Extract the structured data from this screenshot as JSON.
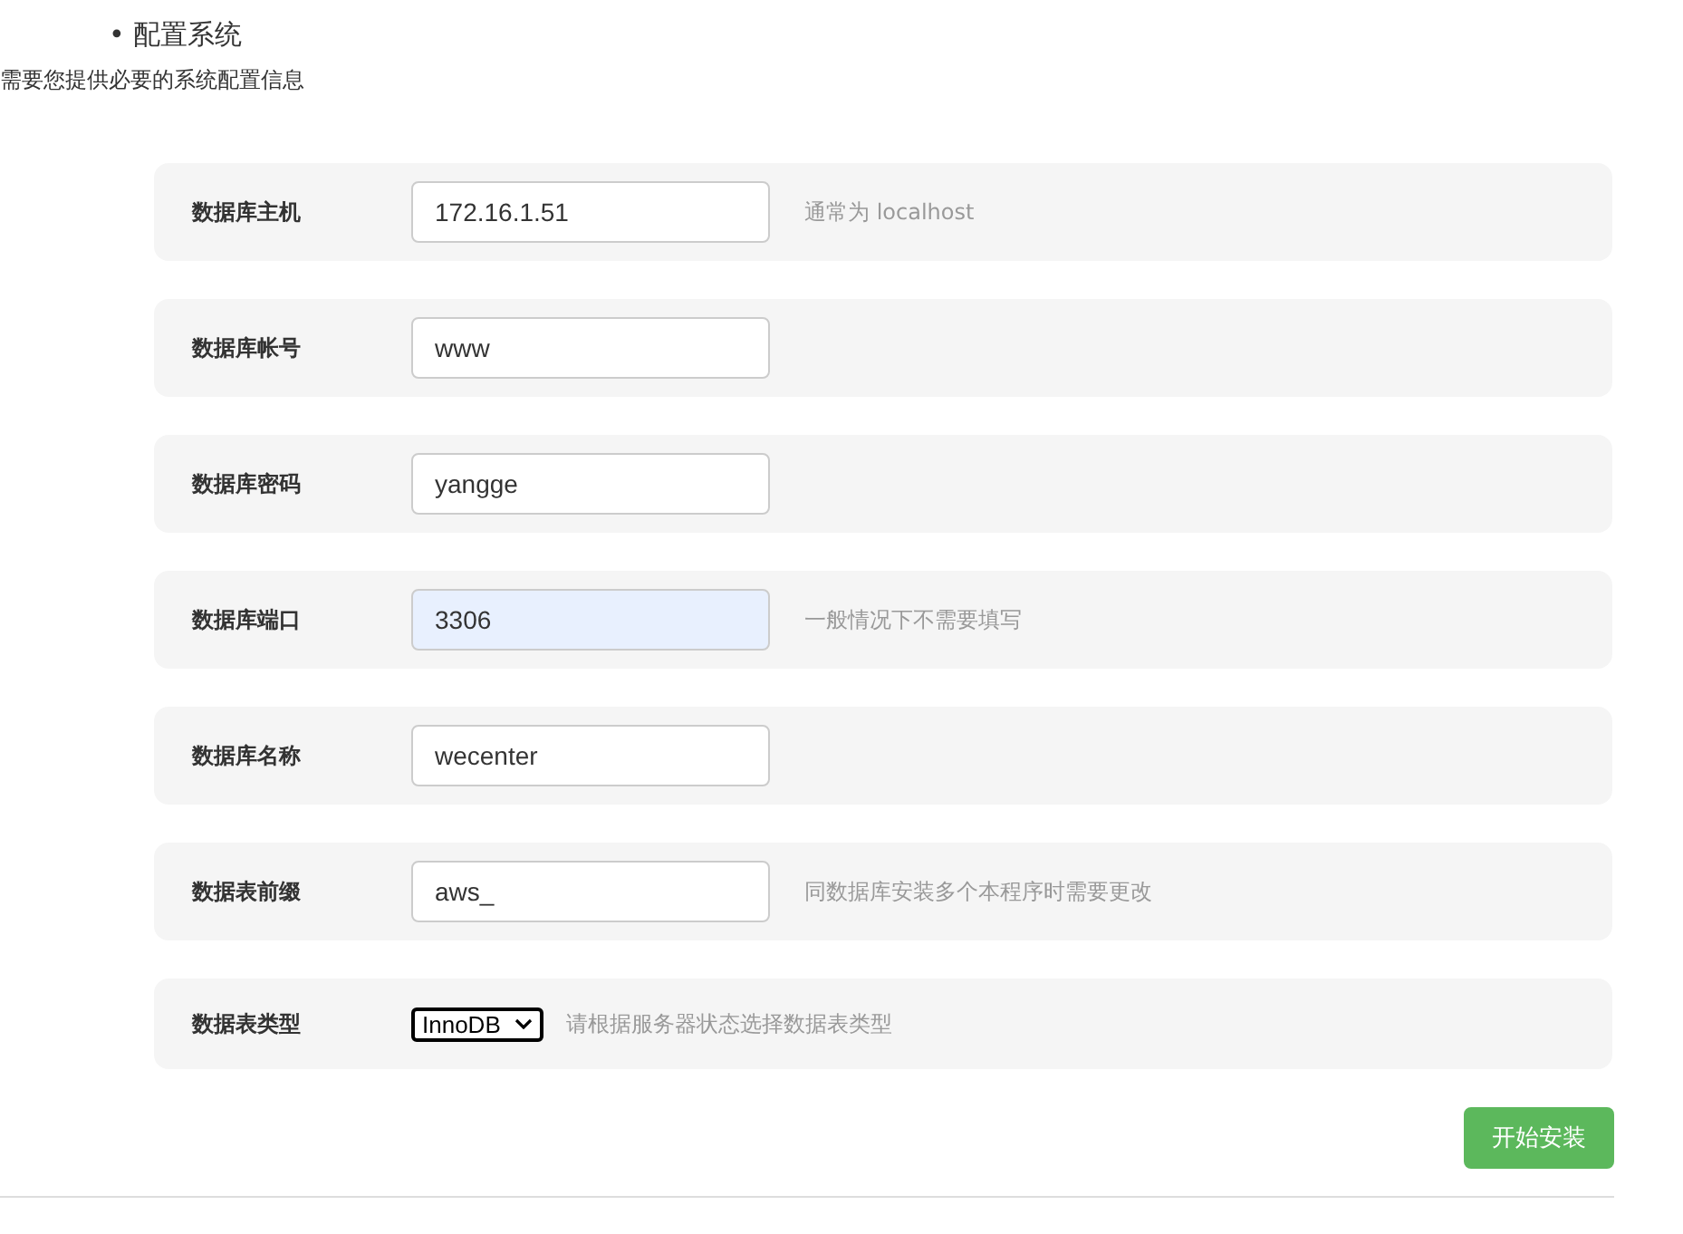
{
  "section": {
    "title": "• 配置系统",
    "description": "需要您提供必要的系统配置信息"
  },
  "fields": [
    {
      "kind": "input",
      "label": "数据库主机",
      "value": "172.16.1.51",
      "autofilled": false,
      "hint": "通常为 localhost"
    },
    {
      "kind": "input",
      "label": "数据库帐号",
      "value": "www",
      "autofilled": false
    },
    {
      "kind": "input",
      "label": "数据库密码",
      "value": "yangge",
      "autofilled": false
    },
    {
      "kind": "input",
      "label": "数据库端口",
      "value": "3306",
      "autofilled": true,
      "hint": "一般情况下不需要填写"
    },
    {
      "kind": "input",
      "label": "数据库名称",
      "value": "wecenter",
      "autofilled": false
    },
    {
      "kind": "input",
      "label": "数据表前缀",
      "value": "aws_",
      "autofilled": false,
      "hint": "同数据库安装多个本程序时需要更改"
    },
    {
      "kind": "select",
      "label": "数据表类型",
      "value": "InnoDB",
      "hint": "请根据服务器状态选择数据表类型"
    }
  ],
  "submit_button": "开始安装"
}
